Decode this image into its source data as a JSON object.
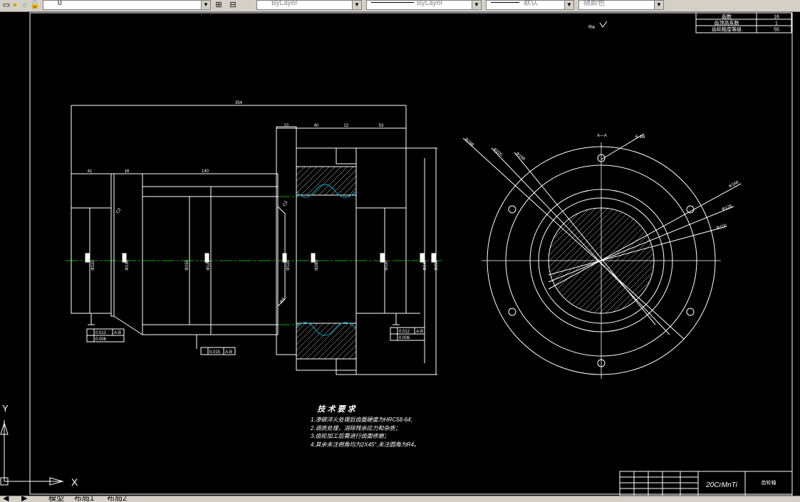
{
  "toolbar": {
    "layer_value": "0",
    "color_combo": "ByLayer",
    "linetype_combo": "ByLayer",
    "lineweight_combo": "默认",
    "plotstyle_combo": "随颜色"
  },
  "title_table": {
    "rows": [
      {
        "label": "齿数",
        "value": "16"
      },
      {
        "label": "齿顶高系数",
        "value": "1"
      },
      {
        "label": "齿轮精度等级",
        "value": "55"
      }
    ]
  },
  "roughness_note": "Ra",
  "dimensions": {
    "overall_length": "354",
    "left_segment": "41",
    "groove": "16",
    "middle_length": "140",
    "flange_left": "22",
    "flange_mid": "40",
    "flange_right": "22",
    "right_shaft": "53",
    "d1": "Φ110",
    "d2": "Φ130",
    "d3": "Φ150",
    "d4": "Φ120",
    "d5": "Φ280",
    "d6": "Φ110",
    "d7": "Φ240",
    "d8": "Φ250",
    "chamfer": "C2",
    "chamfer2": "R4",
    "circle_d1": "Φ168",
    "circle_d2": "Φ128",
    "circle_d3": "Φ100",
    "circle_d4": "Φ248",
    "circle_d5": "Φ200",
    "holes": "6-Φ8",
    "section_label": "A—A"
  },
  "tolerances": {
    "left": {
      "runout": "0.012",
      "ref": "A-B",
      "cyl": "0.006"
    },
    "middle": {
      "runout": "0.015",
      "ref": "A-B"
    },
    "right": {
      "runout": "0.012",
      "ref": "A-B",
      "cyl": "0.006"
    }
  },
  "tech_requirements": {
    "title": "技 术 要 求",
    "items": [
      "1.渗碳淬火处理后齿面硬度为HRC58-64;",
      "2.调质处理，消除残余应力和杂质；",
      "3.齿轮加工后需进行齿面修磨；",
      "4.其余未注倒角均为2X45°,未注圆角为R4。"
    ]
  },
  "title_block": {
    "material": "20CrMnTi",
    "part_name": "齿轮轴"
  },
  "ucs": {
    "x": "X",
    "y": "Y"
  },
  "layout_tabs": [
    "模型",
    "布局1",
    "布局2"
  ],
  "colors": {
    "background": "#000000",
    "lines": "#ffffff",
    "center": "#00aa00",
    "accent": "#00b0d0"
  }
}
